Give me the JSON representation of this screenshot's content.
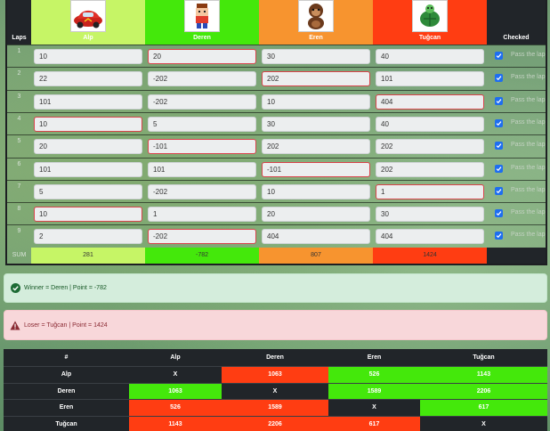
{
  "laps_table": {
    "laps_header": "Laps",
    "checked_header": "Checked",
    "players": [
      {
        "name": "Alp",
        "avatar_icon": "red-race-car-icon",
        "color": "#c6f566"
      },
      {
        "name": "Deren",
        "avatar_icon": "pixel-boy-icon",
        "color": "#44e80b"
      },
      {
        "name": "Eren",
        "avatar_icon": "brown-monkey-icon",
        "color": "#f7942f"
      },
      {
        "name": "Tuğcan",
        "avatar_icon": "green-turtle-icon",
        "color": "#ff3d12"
      }
    ],
    "rows": [
      {
        "lap": "1",
        "values": [
          "10",
          "20",
          "30",
          "40"
        ],
        "highlight": [
          false,
          true,
          false,
          false
        ],
        "pass": "Pass the lap"
      },
      {
        "lap": "2",
        "values": [
          "22",
          "-202",
          "202",
          "101"
        ],
        "highlight": [
          false,
          false,
          true,
          false
        ],
        "pass": "Pass the lap"
      },
      {
        "lap": "3",
        "values": [
          "101",
          "-202",
          "10",
          "404"
        ],
        "highlight": [
          false,
          false,
          false,
          true
        ],
        "pass": "Pass the lap"
      },
      {
        "lap": "4",
        "values": [
          "10",
          "5",
          "30",
          "40"
        ],
        "highlight": [
          true,
          false,
          false,
          false
        ],
        "pass": "Pass the lap"
      },
      {
        "lap": "5",
        "values": [
          "20",
          "-101",
          "202",
          "202"
        ],
        "highlight": [
          false,
          true,
          false,
          false
        ],
        "pass": "Pass the lap"
      },
      {
        "lap": "6",
        "values": [
          "101",
          "101",
          "-101",
          "202"
        ],
        "highlight": [
          false,
          false,
          true,
          false
        ],
        "pass": "Pass the lap"
      },
      {
        "lap": "7",
        "values": [
          "5",
          "-202",
          "10",
          "1"
        ],
        "highlight": [
          false,
          false,
          false,
          true
        ],
        "pass": "Pass the lap"
      },
      {
        "lap": "8",
        "values": [
          "10",
          "1",
          "20",
          "30"
        ],
        "highlight": [
          true,
          false,
          false,
          false
        ],
        "pass": "Pass the lap"
      },
      {
        "lap": "9",
        "values": [
          "2",
          "-202",
          "404",
          "404"
        ],
        "highlight": [
          false,
          true,
          false,
          false
        ],
        "pass": "Pass the lap"
      }
    ],
    "sum_label": "SUM",
    "sums": [
      "281",
      "-782",
      "807",
      "1424"
    ]
  },
  "winner_alert": {
    "text": "Winner = Deren | Point = -782",
    "icon": "check-circle-icon"
  },
  "loser_alert": {
    "text": "Loser = Tuğcan | Point = 1424",
    "icon": "warning-triangle-icon"
  },
  "matrix": {
    "headers": [
      "#",
      "Alp",
      "Deren",
      "Eren",
      "Tuğcan"
    ],
    "rows": [
      {
        "label": "Alp",
        "cells": [
          {
            "v": "X",
            "c": "#212529"
          },
          {
            "v": "1063",
            "c": "#ff3d12"
          },
          {
            "v": "526",
            "c": "#44e80b"
          },
          {
            "v": "1143",
            "c": "#44e80b"
          }
        ]
      },
      {
        "label": "Deren",
        "cells": [
          {
            "v": "1063",
            "c": "#44e80b"
          },
          {
            "v": "X",
            "c": "#212529"
          },
          {
            "v": "1589",
            "c": "#44e80b"
          },
          {
            "v": "2206",
            "c": "#44e80b"
          }
        ]
      },
      {
        "label": "Eren",
        "cells": [
          {
            "v": "526",
            "c": "#ff3d12"
          },
          {
            "v": "1589",
            "c": "#ff3d12"
          },
          {
            "v": "X",
            "c": "#212529"
          },
          {
            "v": "617",
            "c": "#44e80b"
          }
        ]
      },
      {
        "label": "Tuğcan",
        "cells": [
          {
            "v": "1143",
            "c": "#ff3d12"
          },
          {
            "v": "2206",
            "c": "#ff3d12"
          },
          {
            "v": "617",
            "c": "#ff3d12"
          },
          {
            "v": "X",
            "c": "#212529"
          }
        ]
      }
    ]
  }
}
